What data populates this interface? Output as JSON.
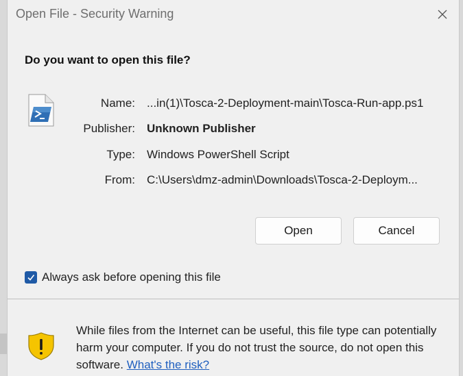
{
  "window": {
    "title": "Open File - Security Warning",
    "close_icon": "close-icon"
  },
  "heading": "Do you want to open this file?",
  "file": {
    "icon": "powershell-script-file-icon",
    "name_label": "Name:",
    "name_value": "...in(1)\\Tosca-2-Deployment-main\\Tosca-Run-app.ps1",
    "publisher_label": "Publisher:",
    "publisher_value": "Unknown Publisher",
    "type_label": "Type:",
    "type_value": "Windows PowerShell Script",
    "from_label": "From:",
    "from_value": "C:\\Users\\dmz-admin\\Downloads\\Tosca-2-Deploym..."
  },
  "buttons": {
    "open": "Open",
    "cancel": "Cancel"
  },
  "checkbox": {
    "checked": true,
    "label": "Always ask before opening this file"
  },
  "warning": {
    "icon": "warning-shield-icon",
    "text": "While files from the Internet can be useful, this file type can potentially harm your computer. If you do not trust the source, do not open this software.",
    "link": "What's the risk?"
  },
  "colors": {
    "accent": "#1f5aa6",
    "link": "#1f5fbf",
    "shield": "#f5c400"
  }
}
